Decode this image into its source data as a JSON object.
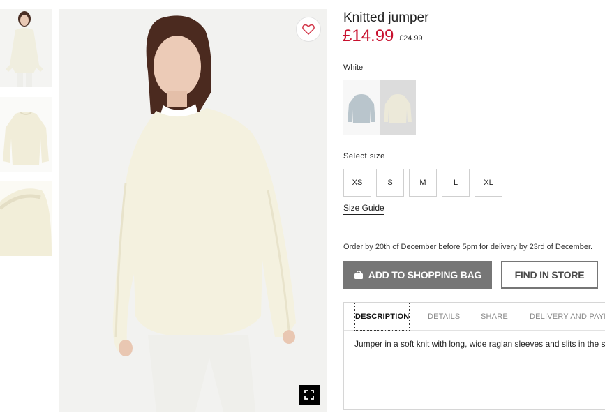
{
  "product": {
    "title": "Knitted jumper",
    "price": "£14.99",
    "old_price": "£24.99",
    "color": "White"
  },
  "swatches": [
    {
      "name": "Light blue",
      "color": "#b9c5cc"
    },
    {
      "name": "White",
      "color": "#ece9d9"
    }
  ],
  "sizes": {
    "label": "Select size",
    "options": [
      "XS",
      "S",
      "M",
      "L",
      "XL"
    ],
    "guide_label": "Size Guide"
  },
  "delivery_note": "Order by 20th of December before 5pm for delivery by 23rd of December.",
  "actions": {
    "add_to_bag": "ADD TO SHOPPING BAG",
    "find_in_store": "FIND IN STORE"
  },
  "tabs": {
    "items": [
      "DESCRIPTION",
      "DETAILS",
      "SHARE",
      "DELIVERY AND PAYMENT"
    ],
    "active": "DESCRIPTION",
    "description_text": "Jumper in a soft knit with long, wide raglan sleeves and slits in the sides."
  },
  "icons": {
    "favourite": "heart-icon",
    "zoom": "expand-icon",
    "bag": "shopping-bag-icon"
  },
  "colors": {
    "price_red": "#c8102e",
    "button_grey": "#767676",
    "heart_red": "#d3384a"
  }
}
